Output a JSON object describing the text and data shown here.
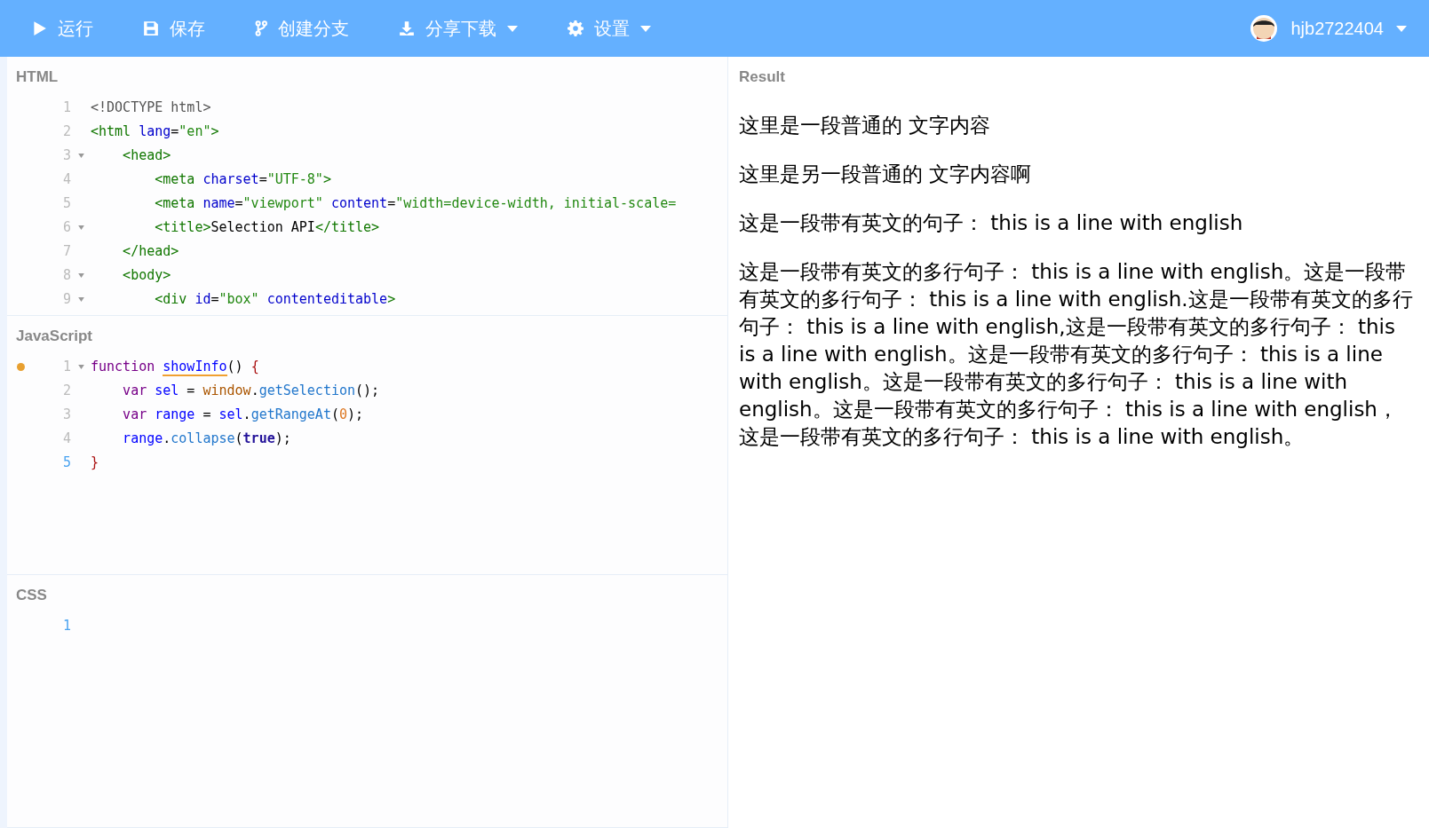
{
  "toolbar": {
    "items": [
      {
        "kind": "run",
        "label": "运行",
        "dropdown": false
      },
      {
        "kind": "save",
        "label": "保存",
        "dropdown": false
      },
      {
        "kind": "branch",
        "label": "创建分支",
        "dropdown": false
      },
      {
        "kind": "download",
        "label": "分享下载",
        "dropdown": true
      },
      {
        "kind": "settings",
        "label": "设置",
        "dropdown": true
      }
    ],
    "user": {
      "name": "hjb2722404",
      "dropdown": true
    }
  },
  "editors": [
    {
      "title": "HTML",
      "lines": [
        {
          "number": "1",
          "fold": false,
          "breakpoint": false,
          "active": false,
          "tokens": [
            {
              "kind": "meta",
              "t": "<!DOCTYPE html>"
            }
          ]
        },
        {
          "number": "2",
          "fold": false,
          "breakpoint": false,
          "active": false,
          "tokens": [
            {
              "kind": "tag",
              "t": "<html "
            },
            {
              "kind": "attr",
              "t": "lang"
            },
            {
              "kind": "plain",
              "t": "="
            },
            {
              "kind": "str",
              "t": "\"en\""
            },
            {
              "kind": "tag",
              "t": ">"
            }
          ]
        },
        {
          "number": "3",
          "fold": true,
          "breakpoint": false,
          "active": false,
          "tokens": [
            {
              "kind": "tag",
              "t": "    <head>"
            }
          ]
        },
        {
          "number": "4",
          "fold": false,
          "breakpoint": false,
          "active": false,
          "tokens": [
            {
              "kind": "tag",
              "t": "        <meta "
            },
            {
              "kind": "attr",
              "t": "charset"
            },
            {
              "kind": "plain",
              "t": "="
            },
            {
              "kind": "str",
              "t": "\"UTF-8\""
            },
            {
              "kind": "tag",
              "t": ">"
            }
          ]
        },
        {
          "number": "5",
          "fold": false,
          "breakpoint": false,
          "active": false,
          "tokens": [
            {
              "kind": "tag",
              "t": "        <meta "
            },
            {
              "kind": "attr",
              "t": "name"
            },
            {
              "kind": "plain",
              "t": "="
            },
            {
              "kind": "str",
              "t": "\"viewport\" "
            },
            {
              "kind": "attr",
              "t": "content"
            },
            {
              "kind": "plain",
              "t": "="
            },
            {
              "kind": "str",
              "t": "\"width=device-width, initial-scale="
            }
          ]
        },
        {
          "number": "6",
          "fold": true,
          "breakpoint": false,
          "active": false,
          "tokens": [
            {
              "kind": "tag",
              "t": "        <title>"
            },
            {
              "kind": "plain",
              "t": "Selection API"
            },
            {
              "kind": "tag",
              "t": "</title>"
            }
          ]
        },
        {
          "number": "7",
          "fold": false,
          "breakpoint": false,
          "active": false,
          "tokens": [
            {
              "kind": "tag",
              "t": "    </head>"
            }
          ]
        },
        {
          "number": "8",
          "fold": true,
          "breakpoint": false,
          "active": false,
          "tokens": [
            {
              "kind": "tag",
              "t": "    <body>"
            }
          ]
        },
        {
          "number": "9",
          "fold": true,
          "breakpoint": false,
          "active": false,
          "tokens": [
            {
              "kind": "tag",
              "t": "        <div "
            },
            {
              "kind": "attr",
              "t": "id"
            },
            {
              "kind": "plain",
              "t": "="
            },
            {
              "kind": "str",
              "t": "\"box\" "
            },
            {
              "kind": "attr",
              "t": "contenteditable"
            },
            {
              "kind": "tag",
              "t": ">"
            }
          ]
        }
      ]
    },
    {
      "title": "JavaScript",
      "lines": [
        {
          "number": "1",
          "fold": true,
          "breakpoint": true,
          "active": false,
          "tokens": [
            {
              "kind": "kw",
              "t": "function "
            },
            {
              "kind": "def",
              "t": "showInfo"
            },
            {
              "kind": "plain",
              "t": "() "
            },
            {
              "kind": "bracket",
              "t": "{"
            }
          ]
        },
        {
          "number": "2",
          "fold": false,
          "breakpoint": false,
          "active": false,
          "tokens": [
            {
              "kind": "kw",
              "t": "    var "
            },
            {
              "kind": "var",
              "t": "sel"
            },
            {
              "kind": "plain",
              "t": " = "
            },
            {
              "kind": "global",
              "t": "window"
            },
            {
              "kind": "plain",
              "t": "."
            },
            {
              "kind": "prop",
              "t": "getSelection"
            },
            {
              "kind": "plain",
              "t": "();"
            }
          ]
        },
        {
          "number": "3",
          "fold": false,
          "breakpoint": false,
          "active": false,
          "tokens": [
            {
              "kind": "kw",
              "t": "    var "
            },
            {
              "kind": "var",
              "t": "range"
            },
            {
              "kind": "plain",
              "t": " = "
            },
            {
              "kind": "var",
              "t": "sel"
            },
            {
              "kind": "plain",
              "t": "."
            },
            {
              "kind": "prop",
              "t": "getRangeAt"
            },
            {
              "kind": "plain",
              "t": "("
            },
            {
              "kind": "num",
              "t": "0"
            },
            {
              "kind": "plain",
              "t": ");"
            }
          ]
        },
        {
          "number": "4",
          "fold": false,
          "breakpoint": false,
          "active": false,
          "tokens": [
            {
              "kind": "var",
              "t": "    range"
            },
            {
              "kind": "plain",
              "t": "."
            },
            {
              "kind": "prop",
              "t": "collapse"
            },
            {
              "kind": "plain",
              "t": "("
            },
            {
              "kind": "atom",
              "t": "true"
            },
            {
              "kind": "plain",
              "t": ");"
            }
          ]
        },
        {
          "number": "5",
          "fold": false,
          "breakpoint": false,
          "active": true,
          "tokens": [
            {
              "kind": "bracket",
              "t": "}"
            }
          ]
        }
      ]
    },
    {
      "title": "CSS",
      "lines": [
        {
          "number": "1",
          "fold": false,
          "breakpoint": false,
          "active": true
        }
      ]
    }
  ],
  "result": {
    "title": "Result",
    "paragraphs": [
      "这里是一段普通的 文字内容",
      "这里是另一段普通的 文字内容啊",
      "这是一段带有英文的句子： this is a line with english",
      "这是一段带有英文的多行句子： this is a line with english。这是一段带有英文的多行句子： this is a line with english.这是一段带有英文的多行句子： this is a line with english,这是一段带有英文的多行句子： this is a line with english。这是一段带有英文的多行句子： this is a line with english。这是一段带有英文的多行句子： this is a line with english。这是一段带有英文的多行句子： this is a line with english，这是一段带有英文的多行句子： this is a line with english。"
    ]
  }
}
